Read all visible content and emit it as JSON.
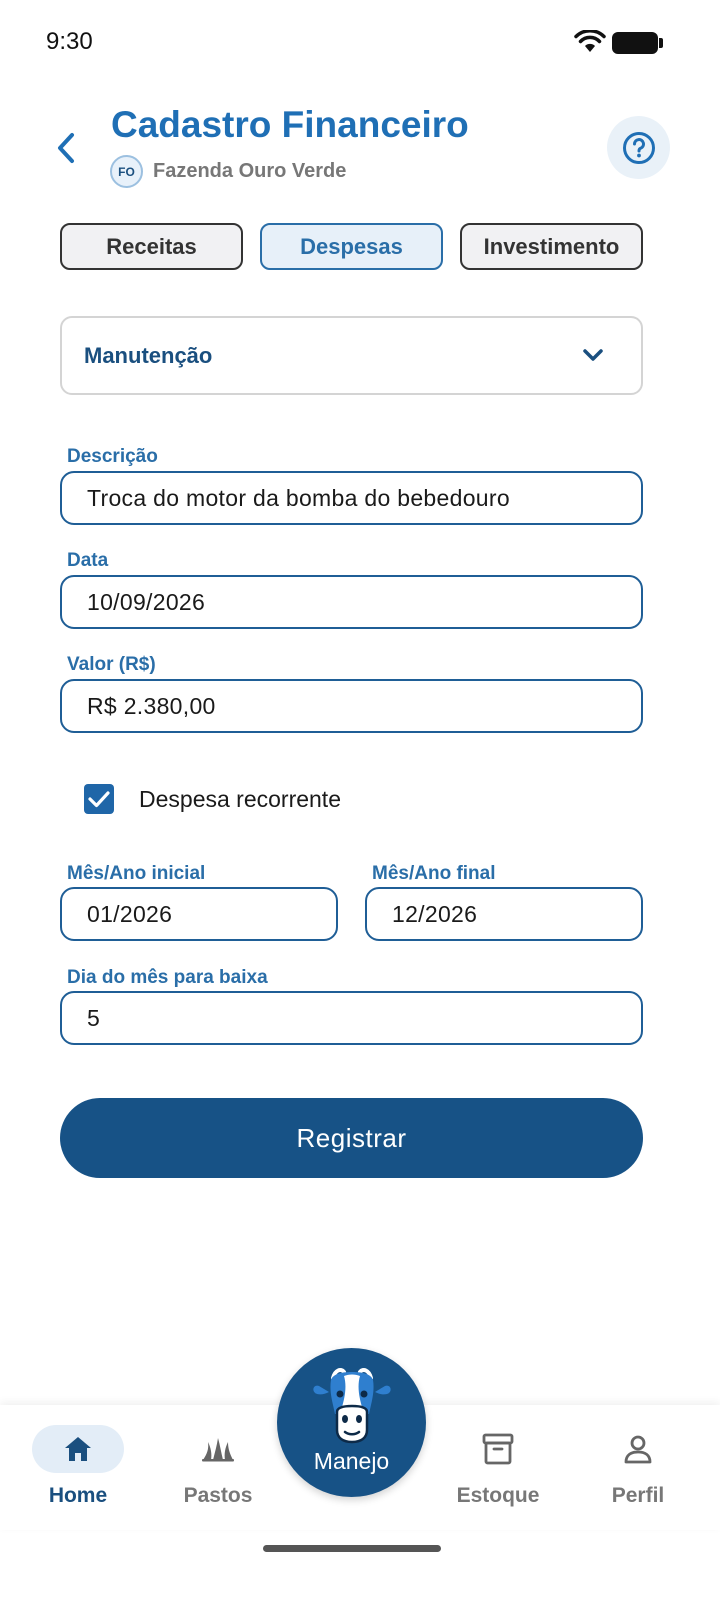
{
  "status_bar": {
    "time": "9:30"
  },
  "header": {
    "title": "Cadastro Financeiro",
    "farm_initials": "FO",
    "farm_name": "Fazenda Ouro Verde"
  },
  "tabs": [
    {
      "label": "Receitas",
      "active": false
    },
    {
      "label": "Despesas",
      "active": true
    },
    {
      "label": "Investimento",
      "active": false
    }
  ],
  "category": {
    "selected": "Manutenção"
  },
  "form": {
    "descricao": {
      "label": "Descrição",
      "value": "Troca do motor da bomba do bebedouro"
    },
    "data": {
      "label": "Data",
      "value": "10/09/2026"
    },
    "valor": {
      "label": "Valor (R$)",
      "value": "R$ 2.380,00"
    },
    "recorrente": {
      "label": "Despesa recorrente",
      "checked": true
    },
    "mes_inicial": {
      "label": "Mês/Ano inicial",
      "value": "01/2026"
    },
    "mes_final": {
      "label": "Mês/Ano final",
      "value": "12/2026"
    },
    "dia_baixa": {
      "label": "Dia do mês para baixa",
      "value": "5"
    }
  },
  "submit_label": "Registrar",
  "bottom_nav": {
    "items": [
      {
        "label": "Home",
        "icon": "home-icon",
        "active": true
      },
      {
        "label": "Pastos",
        "icon": "grass-icon",
        "active": false
      },
      {
        "label": "Estoque",
        "icon": "archive-box-icon",
        "active": false
      },
      {
        "label": "Perfil",
        "icon": "person-icon",
        "active": false
      }
    ],
    "center": {
      "label": "Manejo",
      "icon": "cow-icon"
    }
  },
  "colors": {
    "primary": "#175286",
    "accent": "#2a6ea8",
    "title": "#1f6fb5"
  }
}
